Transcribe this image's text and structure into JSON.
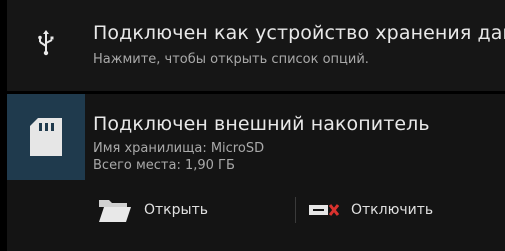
{
  "notifications": [
    {
      "id": "usb",
      "icon": "usb-icon",
      "title": "Подключен как устройство хранения данных",
      "subtitle": "Нажмите, чтобы открыть список опций."
    },
    {
      "id": "sd",
      "icon": "sd-card-icon",
      "title": "Подключен внешний накопитель",
      "lines": [
        "Имя хранилища: MicroSD",
        "Всего места: 1,90 ГБ"
      ],
      "actions": [
        {
          "label": "Открыть",
          "icon": "folder-icon"
        },
        {
          "label": "Отключить",
          "icon": "unmount-icon"
        }
      ]
    }
  ],
  "colors": {
    "accent_icon_bg": "#1f3a4d",
    "unmount_x": "#d9322e"
  }
}
